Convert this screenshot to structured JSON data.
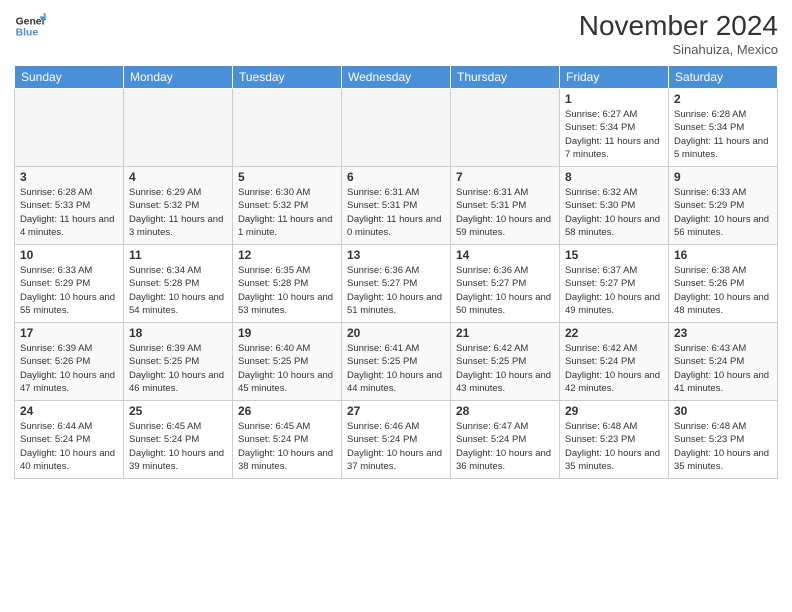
{
  "logo": {
    "text_general": "General",
    "text_blue": "Blue"
  },
  "header": {
    "month": "November 2024",
    "location": "Sinahuiza, Mexico"
  },
  "weekdays": [
    "Sunday",
    "Monday",
    "Tuesday",
    "Wednesday",
    "Thursday",
    "Friday",
    "Saturday"
  ],
  "weeks": [
    [
      {
        "day": "",
        "empty": true
      },
      {
        "day": "",
        "empty": true
      },
      {
        "day": "",
        "empty": true
      },
      {
        "day": "",
        "empty": true
      },
      {
        "day": "",
        "empty": true
      },
      {
        "day": "1",
        "sunrise": "6:27 AM",
        "sunset": "5:34 PM",
        "daylight": "11 hours and 7 minutes."
      },
      {
        "day": "2",
        "sunrise": "6:28 AM",
        "sunset": "5:34 PM",
        "daylight": "11 hours and 5 minutes."
      }
    ],
    [
      {
        "day": "3",
        "sunrise": "6:28 AM",
        "sunset": "5:33 PM",
        "daylight": "11 hours and 4 minutes."
      },
      {
        "day": "4",
        "sunrise": "6:29 AM",
        "sunset": "5:32 PM",
        "daylight": "11 hours and 3 minutes."
      },
      {
        "day": "5",
        "sunrise": "6:30 AM",
        "sunset": "5:32 PM",
        "daylight": "11 hours and 1 minute."
      },
      {
        "day": "6",
        "sunrise": "6:31 AM",
        "sunset": "5:31 PM",
        "daylight": "11 hours and 0 minutes."
      },
      {
        "day": "7",
        "sunrise": "6:31 AM",
        "sunset": "5:31 PM",
        "daylight": "10 hours and 59 minutes."
      },
      {
        "day": "8",
        "sunrise": "6:32 AM",
        "sunset": "5:30 PM",
        "daylight": "10 hours and 58 minutes."
      },
      {
        "day": "9",
        "sunrise": "6:33 AM",
        "sunset": "5:29 PM",
        "daylight": "10 hours and 56 minutes."
      }
    ],
    [
      {
        "day": "10",
        "sunrise": "6:33 AM",
        "sunset": "5:29 PM",
        "daylight": "10 hours and 55 minutes."
      },
      {
        "day": "11",
        "sunrise": "6:34 AM",
        "sunset": "5:28 PM",
        "daylight": "10 hours and 54 minutes."
      },
      {
        "day": "12",
        "sunrise": "6:35 AM",
        "sunset": "5:28 PM",
        "daylight": "10 hours and 53 minutes."
      },
      {
        "day": "13",
        "sunrise": "6:36 AM",
        "sunset": "5:27 PM",
        "daylight": "10 hours and 51 minutes."
      },
      {
        "day": "14",
        "sunrise": "6:36 AM",
        "sunset": "5:27 PM",
        "daylight": "10 hours and 50 minutes."
      },
      {
        "day": "15",
        "sunrise": "6:37 AM",
        "sunset": "5:27 PM",
        "daylight": "10 hours and 49 minutes."
      },
      {
        "day": "16",
        "sunrise": "6:38 AM",
        "sunset": "5:26 PM",
        "daylight": "10 hours and 48 minutes."
      }
    ],
    [
      {
        "day": "17",
        "sunrise": "6:39 AM",
        "sunset": "5:26 PM",
        "daylight": "10 hours and 47 minutes."
      },
      {
        "day": "18",
        "sunrise": "6:39 AM",
        "sunset": "5:25 PM",
        "daylight": "10 hours and 46 minutes."
      },
      {
        "day": "19",
        "sunrise": "6:40 AM",
        "sunset": "5:25 PM",
        "daylight": "10 hours and 45 minutes."
      },
      {
        "day": "20",
        "sunrise": "6:41 AM",
        "sunset": "5:25 PM",
        "daylight": "10 hours and 44 minutes."
      },
      {
        "day": "21",
        "sunrise": "6:42 AM",
        "sunset": "5:25 PM",
        "daylight": "10 hours and 43 minutes."
      },
      {
        "day": "22",
        "sunrise": "6:42 AM",
        "sunset": "5:24 PM",
        "daylight": "10 hours and 42 minutes."
      },
      {
        "day": "23",
        "sunrise": "6:43 AM",
        "sunset": "5:24 PM",
        "daylight": "10 hours and 41 minutes."
      }
    ],
    [
      {
        "day": "24",
        "sunrise": "6:44 AM",
        "sunset": "5:24 PM",
        "daylight": "10 hours and 40 minutes."
      },
      {
        "day": "25",
        "sunrise": "6:45 AM",
        "sunset": "5:24 PM",
        "daylight": "10 hours and 39 minutes."
      },
      {
        "day": "26",
        "sunrise": "6:45 AM",
        "sunset": "5:24 PM",
        "daylight": "10 hours and 38 minutes."
      },
      {
        "day": "27",
        "sunrise": "6:46 AM",
        "sunset": "5:24 PM",
        "daylight": "10 hours and 37 minutes."
      },
      {
        "day": "28",
        "sunrise": "6:47 AM",
        "sunset": "5:24 PM",
        "daylight": "10 hours and 36 minutes."
      },
      {
        "day": "29",
        "sunrise": "6:48 AM",
        "sunset": "5:23 PM",
        "daylight": "10 hours and 35 minutes."
      },
      {
        "day": "30",
        "sunrise": "6:48 AM",
        "sunset": "5:23 PM",
        "daylight": "10 hours and 35 minutes."
      }
    ]
  ]
}
